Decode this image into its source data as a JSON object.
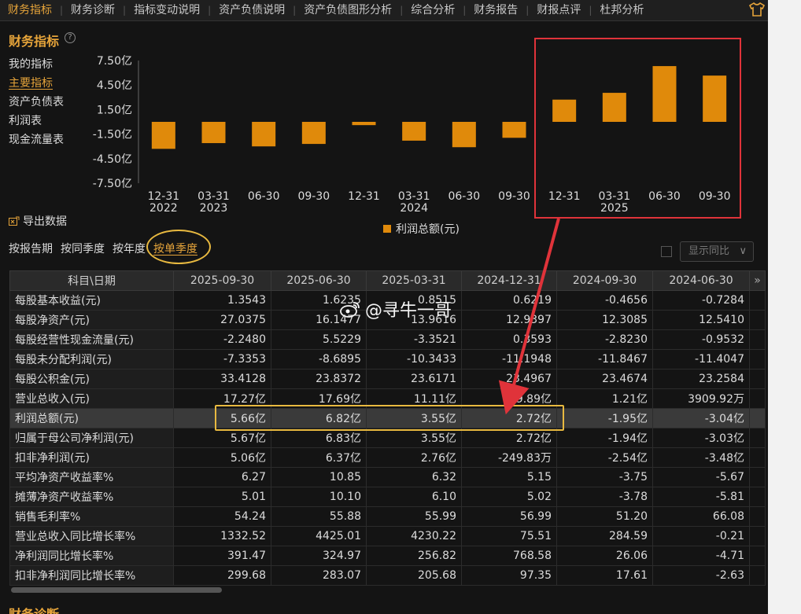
{
  "nav": {
    "tabs": [
      "财务指标",
      "财务诊断",
      "指标变动说明",
      "资产负债说明",
      "资产负债图形分析",
      "综合分析",
      "财务报告",
      "财报点评",
      "杜邦分析"
    ],
    "active_index": 0
  },
  "section": {
    "title": "财务指标",
    "help": "?"
  },
  "sidenav": {
    "items": [
      "我的指标",
      "主要指标",
      "资产负债表",
      "利润表",
      "现金流量表"
    ],
    "active_index": 1
  },
  "chart_data": {
    "type": "bar",
    "categories": [
      "12-31 2022",
      "03-31 2023",
      "06-30",
      "09-30",
      "12-31",
      "03-31 2024",
      "06-30",
      "09-30",
      "12-31",
      "03-31 2025",
      "06-30",
      "09-30"
    ],
    "category_lines": [
      [
        "12-31",
        "2022"
      ],
      [
        "03-31",
        "2023"
      ],
      [
        "06-30",
        ""
      ],
      [
        "09-30",
        ""
      ],
      [
        "12-31",
        ""
      ],
      [
        "03-31",
        "2024"
      ],
      [
        "06-30",
        ""
      ],
      [
        "09-30",
        ""
      ],
      [
        "12-31",
        ""
      ],
      [
        "03-31",
        "2025"
      ],
      [
        "06-30",
        ""
      ],
      [
        "09-30",
        ""
      ]
    ],
    "series": [
      {
        "name": "利润总额(元)",
        "values": [
          -3.3,
          -2.6,
          -3.0,
          -2.7,
          -0.4,
          -2.3,
          -3.1,
          -1.95,
          2.72,
          3.55,
          6.82,
          5.66
        ]
      }
    ],
    "yticks": [
      "7.50亿",
      "4.50亿",
      "1.50亿",
      "-1.50亿",
      "-4.50亿",
      "-7.50亿"
    ],
    "ytick_values": [
      7.5,
      4.5,
      1.5,
      -1.5,
      -4.5,
      -7.5
    ],
    "ylim": [
      -7.5,
      7.5
    ],
    "color": "#e08a0b"
  },
  "export": {
    "label": "导出数据"
  },
  "period_tabs": {
    "items": [
      "按报告期",
      "按同季度",
      "按年度",
      "按单季度"
    ],
    "active_index": 3
  },
  "yoy": {
    "label": "显示同比",
    "chevron": "∨"
  },
  "table": {
    "header": [
      "科目\\日期",
      "2025-09-30",
      "2025-06-30",
      "2025-03-31",
      "2024-12-31",
      "2024-09-30",
      "2024-06-30"
    ],
    "more": "»",
    "rows": [
      [
        "每股基本收益(元)",
        "1.3543",
        "1.6235",
        "0.8515",
        "0.6219",
        "-0.4656",
        "-0.7284"
      ],
      [
        "每股净资产(元)",
        "27.0375",
        "16.1477",
        "13.9616",
        "12.9397",
        "12.3085",
        "12.5410"
      ],
      [
        "每股经营性现金流量(元)",
        "-2.2480",
        "5.5229",
        "-3.3521",
        "0.3593",
        "-2.8230",
        "-0.9532"
      ],
      [
        "每股未分配利润(元)",
        "-7.3353",
        "-8.6895",
        "-10.3433",
        "-11.1948",
        "-11.8467",
        "-11.4047"
      ],
      [
        "每股公积金(元)",
        "33.4128",
        "23.8372",
        "23.6171",
        "23.4967",
        "23.4674",
        "23.2584"
      ],
      [
        "营业总收入(元)",
        "17.27亿",
        "17.69亿",
        "11.11亿",
        "9.89亿",
        "1.21亿",
        "3909.92万"
      ],
      [
        "利润总额(元)",
        "5.66亿",
        "6.82亿",
        "3.55亿",
        "2.72亿",
        "-1.95亿",
        "-3.04亿"
      ],
      [
        "归属于母公司净利润(元)",
        "5.67亿",
        "6.83亿",
        "3.55亿",
        "2.72亿",
        "-1.94亿",
        "-3.03亿"
      ],
      [
        "扣非净利润(元)",
        "5.06亿",
        "6.37亿",
        "2.76亿",
        "-249.83万",
        "-2.54亿",
        "-3.48亿"
      ],
      [
        "平均净资产收益率%",
        "6.27",
        "10.85",
        "6.32",
        "5.15",
        "-3.75",
        "-5.67"
      ],
      [
        "摊薄净资产收益率%",
        "5.01",
        "10.10",
        "6.10",
        "5.02",
        "-3.78",
        "-5.81"
      ],
      [
        "销售毛利率%",
        "54.24",
        "55.88",
        "55.99",
        "56.99",
        "51.20",
        "66.08"
      ],
      [
        "营业总收入同比增长率%",
        "1332.52",
        "4425.01",
        "4230.22",
        "75.51",
        "284.59",
        "-0.21"
      ],
      [
        "净利润同比增长率%",
        "391.47",
        "324.97",
        "256.82",
        "768.58",
        "26.06",
        "-4.71"
      ],
      [
        "扣非净利润同比增长率%",
        "299.68",
        "283.07",
        "205.68",
        "97.35",
        "17.61",
        "-2.63"
      ]
    ],
    "highlight_row": 6
  },
  "watermark": {
    "text": "@寻牛一哥"
  },
  "bottom": {
    "title": "财务诊断"
  },
  "colors": {
    "accent": "#e6a43a",
    "bar": "#e08a0b",
    "annotation_red": "#e0333a",
    "annotation_yellow": "#e8b940"
  }
}
